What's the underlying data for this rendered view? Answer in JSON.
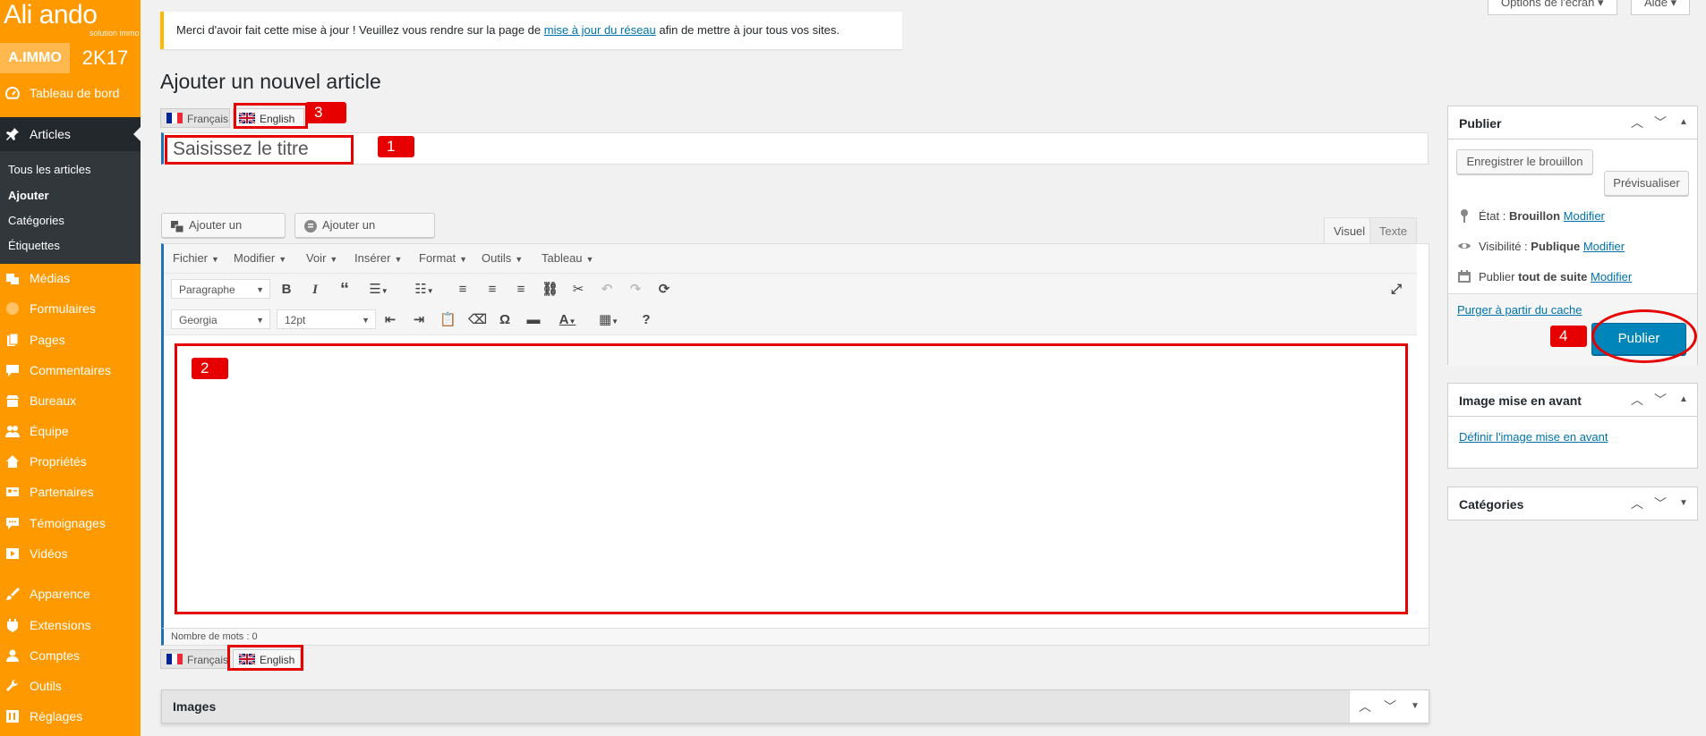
{
  "sidebar": {
    "logo_text": "Ali ando",
    "logo_sub": "solution immo",
    "badge_left": "A.IMMO",
    "badge_right": "2K17",
    "items": {
      "dashboard": "Tableau de bord",
      "articles": "Articles",
      "medias": "Médias",
      "formulaires": "Formulaires",
      "pages": "Pages",
      "commentaires": "Commentaires",
      "bureaux": "Bureaux",
      "equipe": "Équipe",
      "proprietes": "Propriétés",
      "partenaires": "Partenaires",
      "temoignages": "Témoignages",
      "videos": "Vidéos",
      "apparence": "Apparence",
      "extensions": "Extensions",
      "comptes": "Comptes",
      "outils": "Outils",
      "reglages": "Réglages"
    },
    "submenu": {
      "all": "Tous les articles",
      "add": "Ajouter",
      "categories": "Catégories",
      "tags": "Étiquettes"
    }
  },
  "top": {
    "screen_options": "Options de l'écran ▾",
    "help": "Aide ▾"
  },
  "notice": {
    "before": "Merci d'avoir fait cette mise à jour ! Veuillez vous rendre sur la page de ",
    "link": "mise à jour du réseau",
    "after": " afin de mettre à jour tous vos sites."
  },
  "page_title": "Ajouter un nouvel article",
  "languages": {
    "fr": "Français",
    "en": "English"
  },
  "title_field": {
    "placeholder": "Saisissez le titre"
  },
  "editor": {
    "add_media": "Ajouter un média",
    "add_form": "Ajouter un formulaire",
    "tab_visual": "Visuel",
    "tab_text": "Texte",
    "menus": [
      "Fichier",
      "Modifier",
      "Voir",
      "Insérer",
      "Format",
      "Outils",
      "Tableau"
    ],
    "format_select": "Paragraphe",
    "font_select": "Georgia",
    "size_select": "12pt",
    "word_count": "Nombre de mots : 0"
  },
  "annotations": [
    "1",
    "2",
    "3",
    "4"
  ],
  "publish_box": {
    "title": "Publier",
    "save_draft": "Enregistrer le brouillon",
    "preview": "Prévisualiser",
    "status_label": "État : ",
    "status_value": "Brouillon",
    "visibility_label": "Visibilité : ",
    "visibility_value": "Publique",
    "publish_label": "Publier ",
    "publish_value": "tout de suite",
    "modify": "Modifier",
    "purge_cache": "Purger à partir du cache",
    "publish_button": "Publier"
  },
  "featured_box": {
    "title": "Image mise en avant",
    "set_link": "Définir l'image mise en avant"
  },
  "categories_box": {
    "title": "Catégories"
  },
  "images_box": {
    "title": "Images"
  },
  "colors": {
    "sidebar": "#ff9900",
    "sidebar_active": "#23282d",
    "accent": "#0085ba",
    "annotation": "#e60000"
  }
}
